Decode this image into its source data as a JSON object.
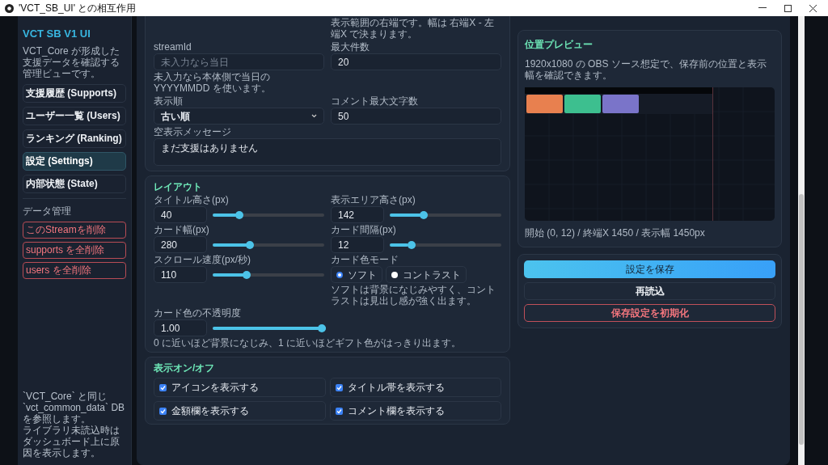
{
  "window": {
    "title": "'VCT_SB_UI' との相互作用"
  },
  "sidebar": {
    "title": "VCT SB V1 UI",
    "description": "VCT_Core が形成した支援データを確認する管理ビューです。",
    "nav": [
      {
        "label": "支援履歴 (Supports)",
        "selected": false
      },
      {
        "label": "ユーザー一覧 (Users)",
        "selected": false
      },
      {
        "label": "ランキング (Ranking)",
        "selected": false
      },
      {
        "label": "設定 (Settings)",
        "selected": true
      },
      {
        "label": "内部状態 (State)",
        "selected": false
      }
    ],
    "data_heading": "データ管理",
    "data_actions": [
      "このStreamを削除",
      "supports を全削除",
      "users を全削除"
    ],
    "footer": [
      "`VCT_Core` と同じ `vct_common_data` DB を参照します。",
      "ライブラリ未読込時はダッシュボード上に原因を表示します。"
    ]
  },
  "general": {
    "top_hint": "表示範囲の右端です。幅は 右端X - 左端X で決まります。",
    "fields": [
      {
        "kind": "text",
        "label": "streamId",
        "placeholder": "未入力なら当日",
        "hint": "未入力なら本体側で当日の YYYYMMDD を使います。"
      },
      {
        "kind": "text",
        "label": "最大件数",
        "value": "20"
      },
      {
        "kind": "select",
        "label": "表示順",
        "value": "古い順"
      },
      {
        "kind": "text",
        "label": "コメント最大文字数",
        "value": "50"
      },
      {
        "kind": "textarea",
        "label": "空表示メッセージ",
        "value": "まだ支援はありません"
      }
    ]
  },
  "layout": {
    "title": "レイアウト",
    "items": [
      {
        "kind": "slider",
        "label": "タイトル高さ(px)",
        "value": "40",
        "level": 0.22
      },
      {
        "kind": "slider",
        "label": "表示エリア高さ(px)",
        "value": "142",
        "level": 0.29
      },
      {
        "kind": "slider",
        "label": "カード幅(px)",
        "value": "280",
        "level": 0.32
      },
      {
        "kind": "slider",
        "label": "カード間隔(px)",
        "value": "12",
        "level": 0.17
      },
      {
        "kind": "slider",
        "label": "スクロール速度(px/秒)",
        "value": "110",
        "level": 0.29
      },
      {
        "kind": "radio",
        "label": "カード色モード",
        "options": [
          {
            "label": "ソフト",
            "selected": true
          },
          {
            "label": "コントラスト",
            "selected": false
          }
        ],
        "hint": "ソフトは背景になじみやすく、コントラストは見出し感が強く出ます。"
      },
      {
        "kind": "slider",
        "label": "カード色の不透明度",
        "value": "1.00",
        "level": 1,
        "hint": "0 に近いほど背景になじみ、1 に近いほどギフト色がはっきり出ます。"
      }
    ]
  },
  "visibility": {
    "title": "表示オン/オフ",
    "items": [
      {
        "label": "アイコンを表示する",
        "checked": true
      },
      {
        "label": "タイトル帯を表示する",
        "checked": true
      },
      {
        "label": "金額欄を表示する",
        "checked": true
      },
      {
        "label": "コメント欄を表示する",
        "checked": true
      }
    ]
  },
  "preview": {
    "title": "位置プレビュー",
    "description": "1920x1080 の OBS ソース想定で、保存前の位置と表示幅を確認できます。",
    "caption": "開始 (0, 12) / 終端X 1450 / 表示幅 1450px"
  },
  "actions": [
    {
      "label": "設定を保存",
      "kind": "primary"
    },
    {
      "label": "再読込",
      "kind": "secondary"
    },
    {
      "label": "保存設定を初期化",
      "kind": "danger"
    }
  ]
}
